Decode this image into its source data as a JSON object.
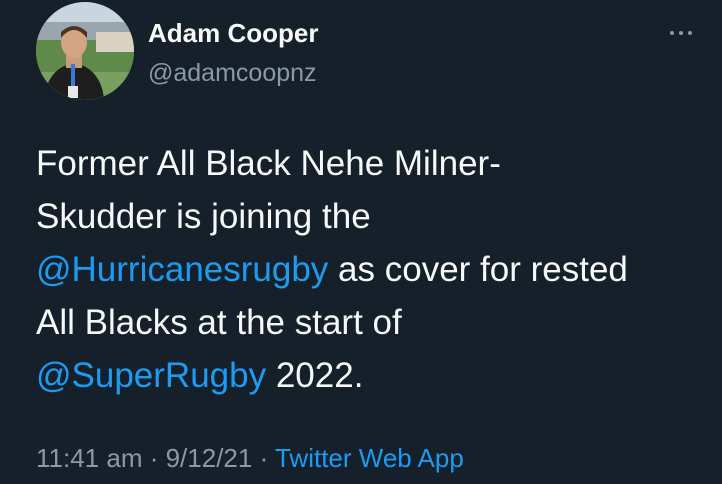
{
  "author": {
    "display_name": "Adam Cooper",
    "handle": "@adamcoopnz",
    "avatar_icon": "profile-photo"
  },
  "more_icon": "more-horizontal-icon",
  "tweet": {
    "line1": "Former All Black Nehe Milner-",
    "line2": "Skudder is joining the",
    "line3_mention": "@Hurricanesrugby",
    "line3_rest": " as cover for rested",
    "line4": "All Blacks at the start of",
    "line5_mention": "@SuperRugby",
    "line5_rest": " 2022."
  },
  "meta": {
    "time": "11:41 am",
    "sep1": " · ",
    "date": "9/12/21",
    "sep2": " · ",
    "source": "Twitter Web App"
  },
  "colors": {
    "background": "#15202b",
    "text": "#f7f9f9",
    "secondary": "#8b98a5",
    "link": "#1d9bf0"
  }
}
